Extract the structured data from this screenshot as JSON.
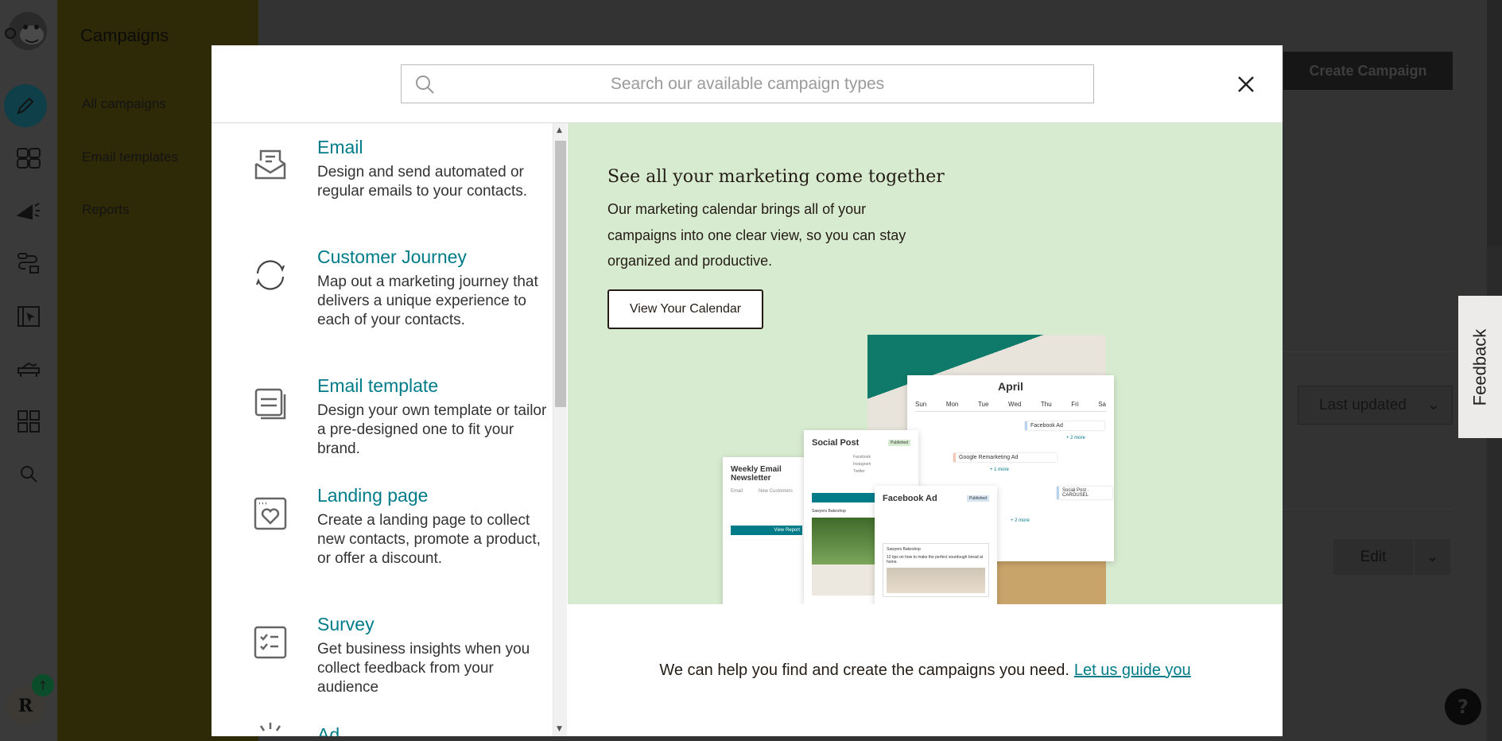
{
  "sidebar": {
    "title": "Campaigns",
    "items": [
      {
        "label": "All campaigns"
      },
      {
        "label": "Email templates"
      },
      {
        "label": "Reports"
      }
    ]
  },
  "rail": {
    "icons": [
      "mailchimp-logo",
      "pencil-icon",
      "audience-icon",
      "megaphone-icon",
      "automations-icon",
      "website-icon",
      "content-studio-icon",
      "integrations-icon",
      "search-icon"
    ],
    "avatar_initial": "R",
    "active_color": "#0f3f48"
  },
  "main": {
    "create_campaign_label": "Create Campaign",
    "sort_label": "Last updated",
    "edit_label": "Edit",
    "feedback_label": "Feedback",
    "help_label": "?"
  },
  "modal": {
    "search_placeholder": "Search our available campaign types",
    "accent": "#007c89",
    "items": [
      {
        "title": "Email",
        "description": "Design and send automated or regular emails to your contacts.",
        "icon": "envelope-icon"
      },
      {
        "title": "Customer Journey",
        "description": "Map out a marketing journey that delivers a unique experience to each of your contacts.",
        "icon": "refresh-cycle-icon"
      },
      {
        "title": "Email template",
        "description": "Design your own template or tailor a pre-designed one to fit your brand.",
        "icon": "template-stack-icon"
      },
      {
        "title": "Landing page",
        "description": "Create a landing page to collect new contacts, promote a product, or offer a discount.",
        "icon": "heart-page-icon"
      },
      {
        "title": "Survey",
        "description": "Get business insights when you collect feedback from your audience",
        "icon": "checklist-icon"
      },
      {
        "title": "Ad",
        "icon": "sparkle-icon"
      }
    ],
    "hero": {
      "heading": "See all your marketing come together",
      "body": "Our marketing calendar brings all of your campaigns into one clear view, so you can stay organized and productive.",
      "button": "View Your Calendar",
      "background": "#d7ebd0",
      "illustration": {
        "month": "April",
        "days": [
          "Sun",
          "Mon",
          "Tue",
          "Wed",
          "Thu",
          "Fri",
          "Sa"
        ],
        "events": [
          "Facebook Ad",
          "Google Remarketing Ad",
          "Social Post · CAROUSEL"
        ],
        "more": [
          "+ 2 more",
          "+ 1 more",
          "+ 2 more"
        ],
        "social_card": {
          "title": "Social Post",
          "status": "Published",
          "networks": [
            "Facebook",
            "Instagram",
            "Twitter"
          ],
          "button": "View Report",
          "brand": "Sawyers Bakeshop"
        },
        "fb_card": {
          "title": "Facebook Ad",
          "status": "Published",
          "brand": "Sawyers Bakeshop",
          "text": "12 tips on how to make the perfect sourdough bread at home."
        },
        "newsletter_card": {
          "title": "Weekly Email Newsletter",
          "type": "Email",
          "audience": "New Customers",
          "button": "View Report"
        }
      }
    },
    "guide_text": "We can help you find and create the campaigns you need.",
    "guide_link": "Let us guide you"
  }
}
